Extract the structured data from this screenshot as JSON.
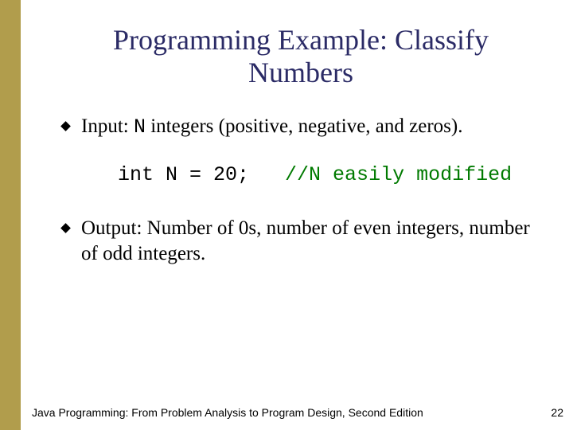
{
  "title": "Programming Example: Classify Numbers",
  "bullets": {
    "input_prefix": "Input: ",
    "input_code": "N",
    "input_rest": " integers (positive, negative, and zeros).",
    "output": "Output: Number of 0s, number of even integers, number of odd integers."
  },
  "code": {
    "stmt": "int N = 20;   ",
    "comment": "//N easily modified"
  },
  "footer": {
    "text": "Java Programming: From Problem Analysis to Program Design, Second Edition",
    "page": "22"
  }
}
